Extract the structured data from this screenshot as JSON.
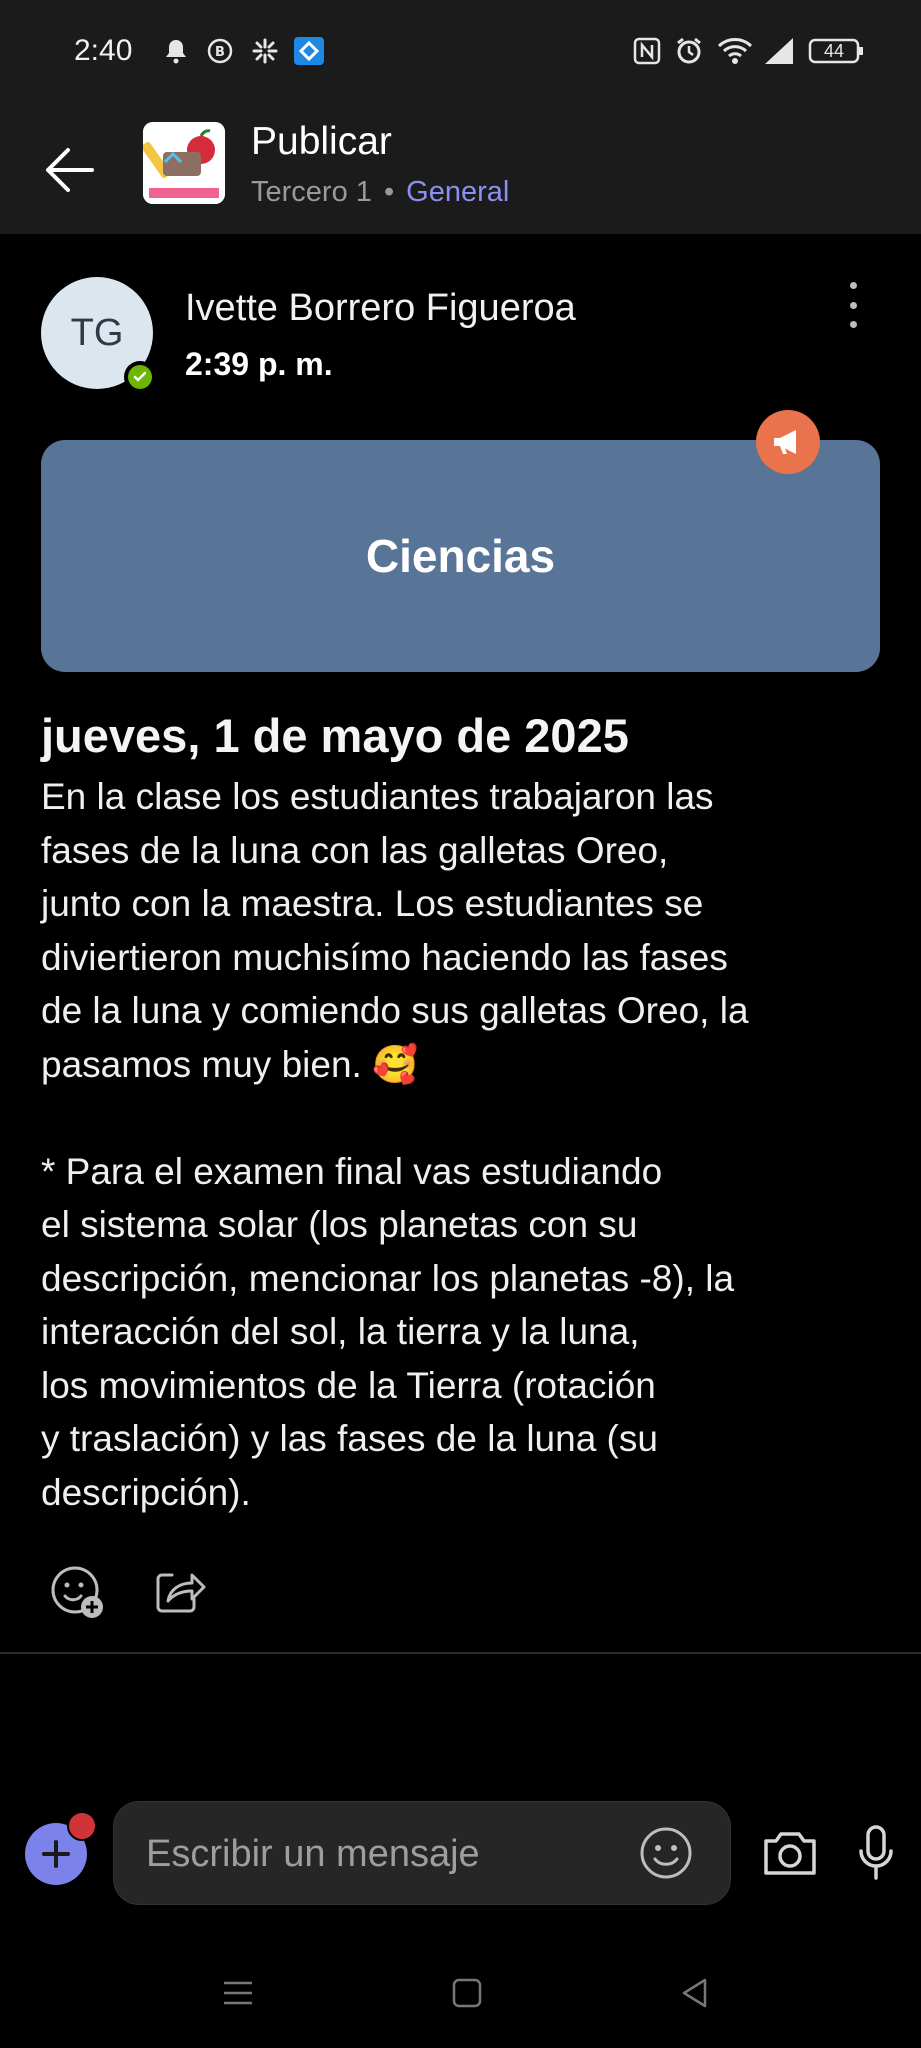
{
  "status_bar": {
    "time": "2:40",
    "battery": "44",
    "left_icons": [
      "bell-icon",
      "b-circle-icon",
      "asterisk-icon",
      "app-badge-icon"
    ],
    "right_icons": [
      "nfc-icon",
      "alarm-icon",
      "wifi-icon",
      "signal-icon",
      "battery-icon"
    ]
  },
  "header": {
    "title": "Publicar",
    "team": "Tercero 1",
    "separator": "•",
    "channel": "General"
  },
  "post": {
    "author_initials": "TG",
    "author_name": "Ivette Borrero Figueroa",
    "time": "2:39 p. m.",
    "card_title": "Ciencias",
    "date_heading": "jueves, 1 de mayo de 2025",
    "body": "En la clase los estudiantes trabajaron las\nfases de la luna con las galletas Oreo,\njunto con la maestra. Los estudiantes se\ndiviertieron muchisímo haciendo las fases\nde la luna y comiendo sus galletas Oreo, la\npasamos muy bien. 🥰\n\n * Para el examen final vas estudiando\nel sistema solar (los planetas con su\ndescripción, mencionar los planetas -8), la\ninteracción del sol, la tierra y la luna,\nlos movimientos de la Tierra (rotación\ny traslación) y las fases de la luna (su\ndescripción)."
  },
  "composer": {
    "placeholder": "Escribir un mensaje"
  },
  "colors": {
    "accent": "#7b83eb",
    "card": "#587497",
    "announcement": "#e8734c",
    "presence": "#6bb700",
    "channel_link": "#8b8ff0"
  }
}
